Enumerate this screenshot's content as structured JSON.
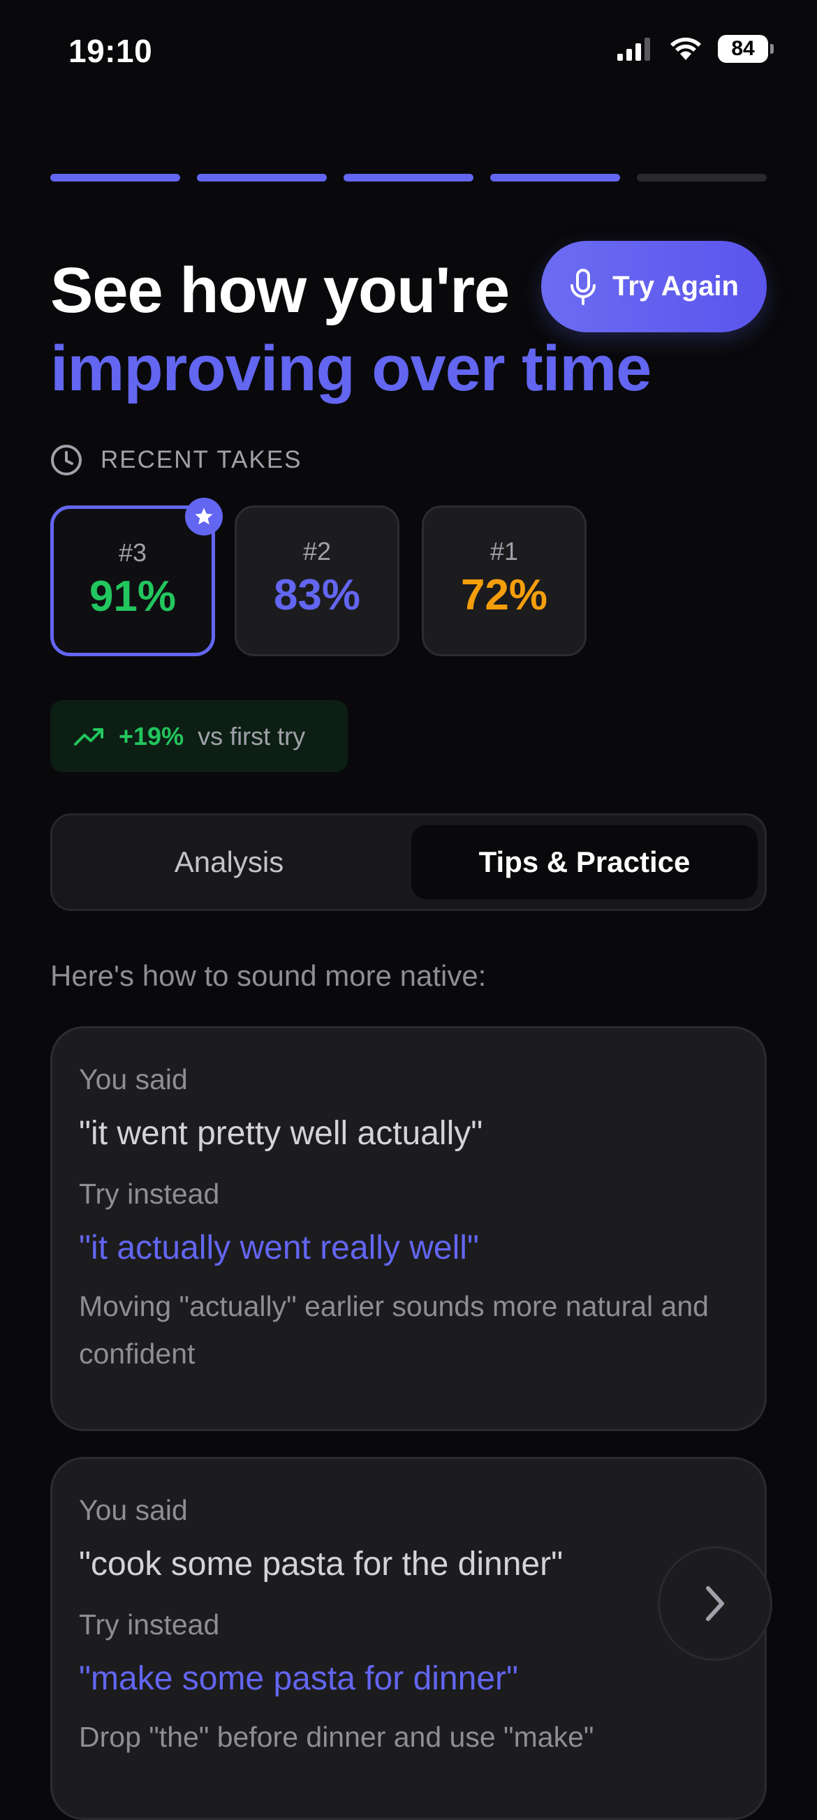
{
  "status_bar": {
    "time": "19:10",
    "battery": "84"
  },
  "progress": {
    "total_steps": 5,
    "completed_steps": 4
  },
  "headline": {
    "line1": "See how you're",
    "line2": "improving over time"
  },
  "try_again_label": "Try Again",
  "recent_takes": {
    "label": "RECENT TAKES",
    "takes": [
      {
        "number": "#3",
        "score": "91%",
        "color": "#22c55e",
        "selected": true
      },
      {
        "number": "#2",
        "score": "83%",
        "color": "#6366f1",
        "selected": false
      },
      {
        "number": "#1",
        "score": "72%",
        "color": "#f59e0b",
        "selected": false
      }
    ]
  },
  "improvement": {
    "delta": "+19%",
    "text": "vs first try"
  },
  "tabs": {
    "analysis": "Analysis",
    "tips": "Tips & Practice",
    "active": "tips"
  },
  "intro": "Here's how to sound more native:",
  "tips": [
    {
      "you_said_label": "You said",
      "you_said": "\"it went pretty well actually\"",
      "try_instead_label": "Try instead",
      "try_instead": "\"it actually went really well\"",
      "explanation": "Moving \"actually\" earlier sounds more natural and confident"
    },
    {
      "you_said_label": "You said",
      "you_said": "\"cook some pasta for the dinner\"",
      "try_instead_label": "Try instead",
      "try_instead": "\"make some pasta for dinner\"",
      "explanation": "Drop \"the\" before dinner and use \"make\""
    }
  ],
  "colors": {
    "accent": "#6366f1",
    "positive": "#22c55e",
    "warning": "#f59e0b",
    "background": "#09090b"
  }
}
